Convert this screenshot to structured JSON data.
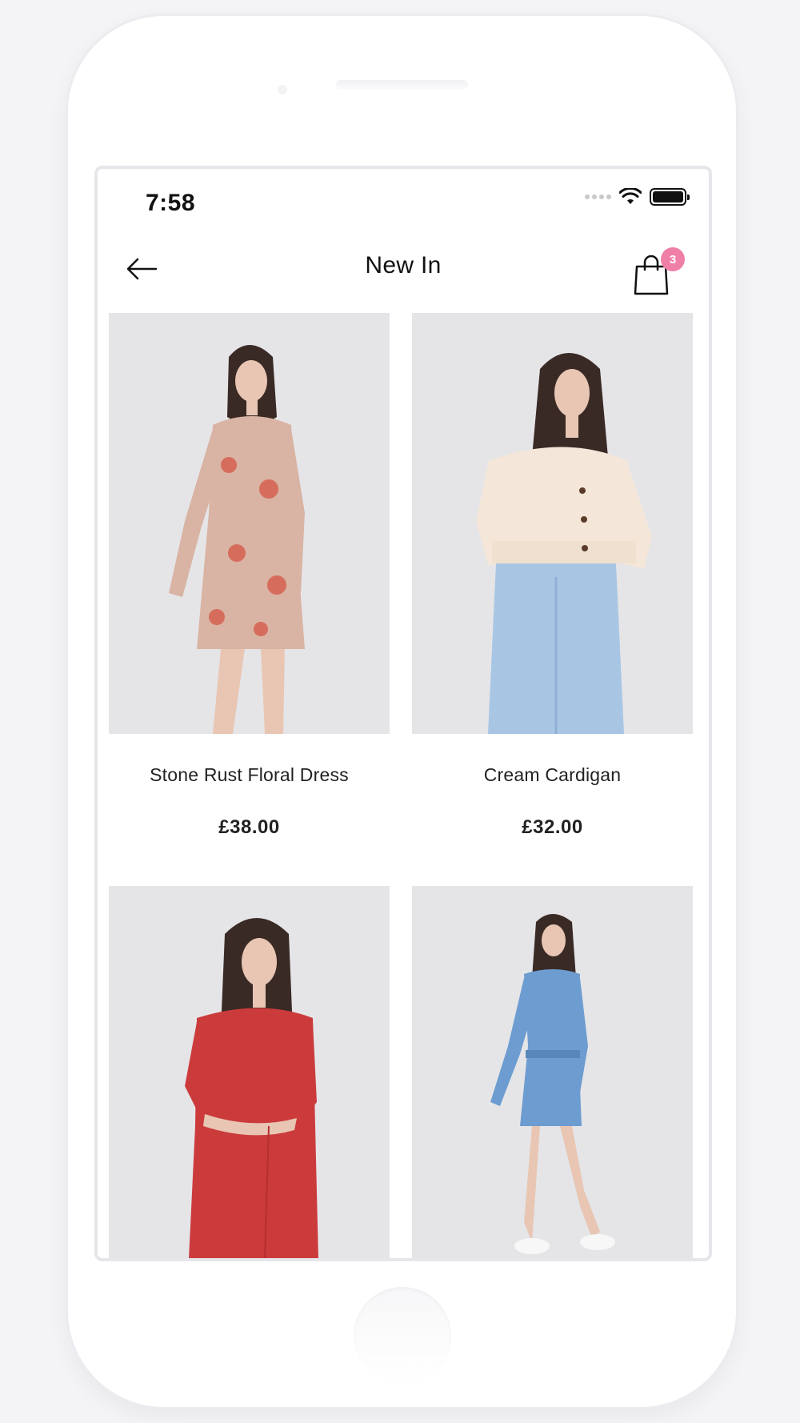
{
  "status_bar": {
    "time": "7:58"
  },
  "header": {
    "title": "New In",
    "cart_count": "3"
  },
  "products": [
    {
      "name": "Stone Rust Floral Dress",
      "price": "£38.00",
      "image_icon": "floral-dress-photo",
      "garment_color": "#d9b3a3",
      "accent_color": "#d45b4a"
    },
    {
      "name": "Cream Cardigan",
      "price": "£32.00",
      "image_icon": "cardigan-photo",
      "garment_color": "#f4e6d8",
      "accent_color": "#a8c6e4"
    },
    {
      "name": "",
      "price": "",
      "image_icon": "red-dress-photo",
      "garment_color": "#cc3b3c",
      "accent_color": "#b52f31"
    },
    {
      "name": "",
      "price": "",
      "image_icon": "denim-dress-photo",
      "garment_color": "#6d9cd0",
      "accent_color": "#5a87bb"
    }
  ],
  "colors": {
    "badge": "#f07fa8",
    "image_background": "#e5e5e8"
  }
}
